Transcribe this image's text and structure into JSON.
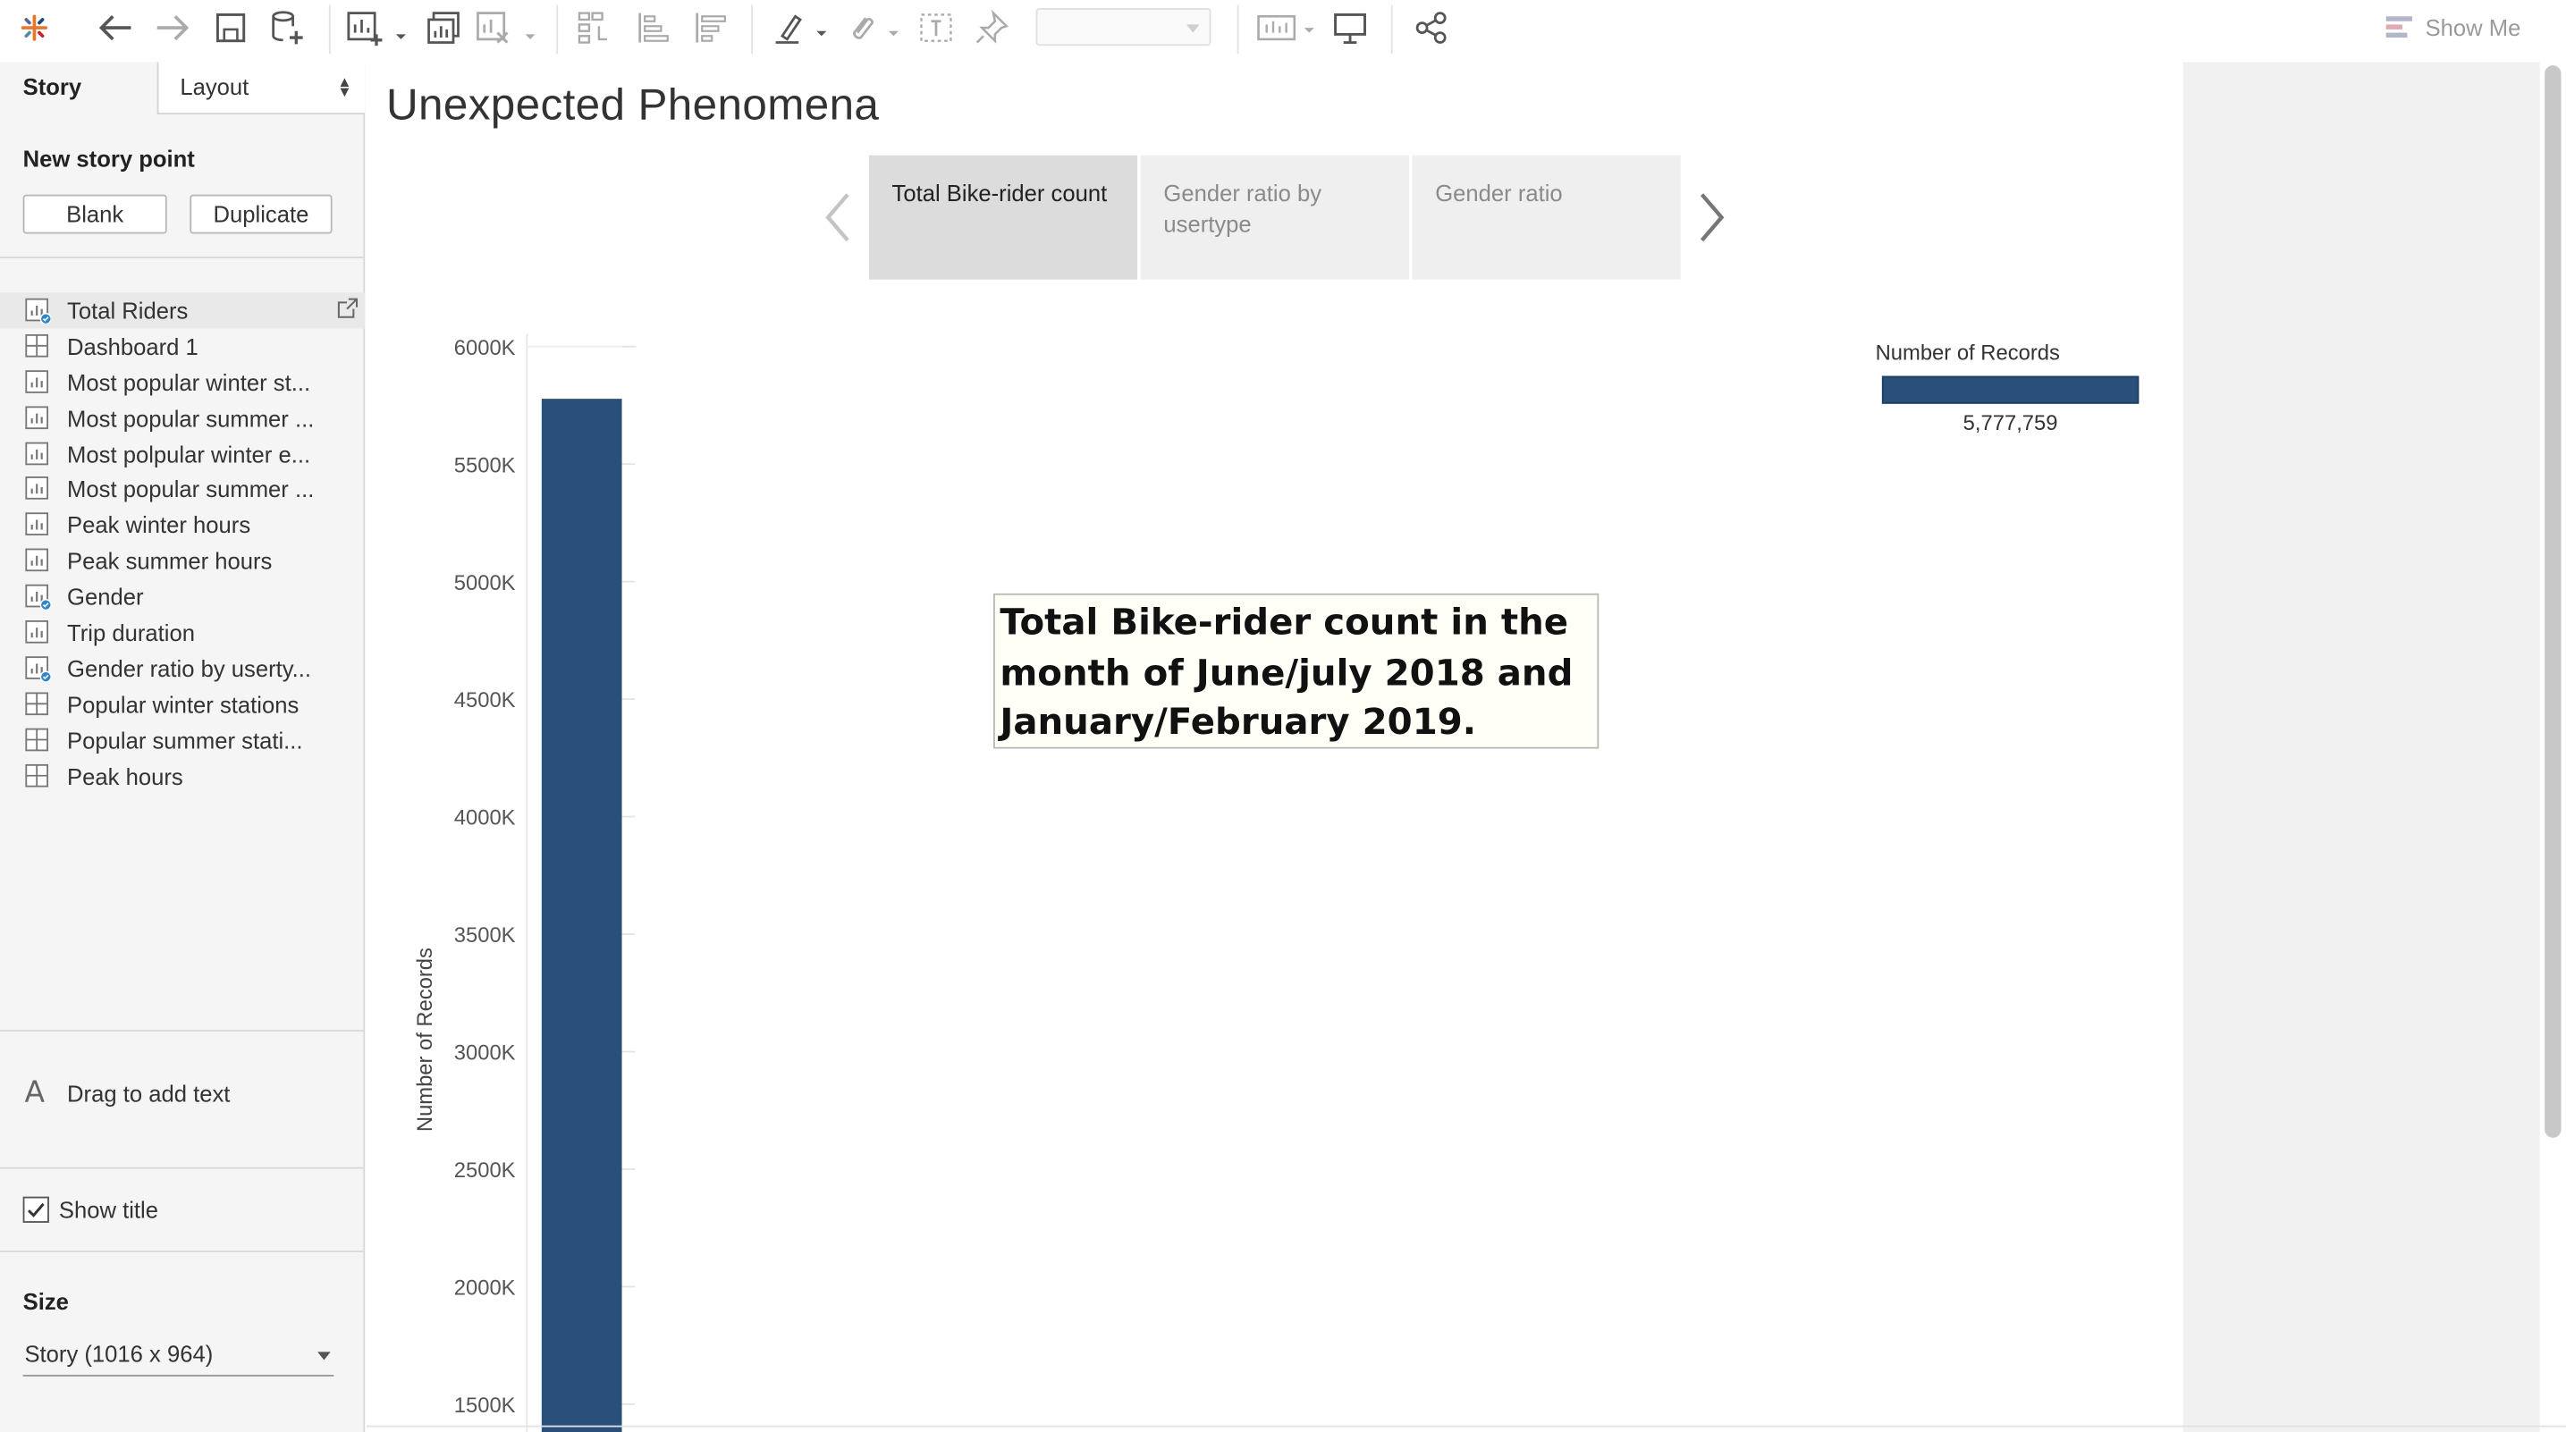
{
  "toolbar": {
    "show_me_label": "Show Me",
    "icons": [
      "tableau-logo-icon",
      "undo-icon",
      "redo-icon",
      "save-icon",
      "new-datasource-icon",
      "new-worksheet-icon",
      "duplicate-sheet-icon",
      "clear-sheet-icon",
      "swap-icon",
      "sort-ascending-icon",
      "sort-descending-icon",
      "highlight-icon",
      "group-icon",
      "label-icon",
      "pin-icon",
      "fit-icon",
      "presentation-icon",
      "share-icon"
    ],
    "fit_value": ""
  },
  "left_pane": {
    "tab_story": "Story",
    "tab_layout": "Layout",
    "new_story_point": "New story point",
    "blank_button": "Blank",
    "duplicate_button": "Duplicate",
    "sheets": [
      {
        "label": "Total Riders",
        "type": "worksheet",
        "used": true,
        "active": true
      },
      {
        "label": "Dashboard 1",
        "type": "dashboard",
        "used": false,
        "active": false
      },
      {
        "label": "Most popular winter st...",
        "type": "worksheet",
        "used": false,
        "active": false
      },
      {
        "label": "Most popular summer ...",
        "type": "worksheet",
        "used": false,
        "active": false
      },
      {
        "label": "Most polpular winter e...",
        "type": "worksheet",
        "used": false,
        "active": false
      },
      {
        "label": "Most popular summer ...",
        "type": "worksheet",
        "used": false,
        "active": false
      },
      {
        "label": "Peak winter hours",
        "type": "worksheet",
        "used": false,
        "active": false
      },
      {
        "label": "Peak summer hours",
        "type": "worksheet",
        "used": false,
        "active": false
      },
      {
        "label": "Gender",
        "type": "worksheet",
        "used": true,
        "active": false
      },
      {
        "label": "Trip duration",
        "type": "worksheet",
        "used": false,
        "active": false
      },
      {
        "label": "Gender ratio by userty...",
        "type": "worksheet",
        "used": true,
        "active": false
      },
      {
        "label": "Popular winter stations",
        "type": "dashboard",
        "used": false,
        "active": false
      },
      {
        "label": "Popular summer stati...",
        "type": "dashboard",
        "used": false,
        "active": false
      },
      {
        "label": "Peak hours",
        "type": "dashboard",
        "used": false,
        "active": false
      }
    ],
    "drag_to_add_text": "Drag to add text",
    "show_title_label": "Show title",
    "show_title_checked": true,
    "size_label": "Size",
    "size_value": "Story (1016 x 964)"
  },
  "story": {
    "title": "Unexpected Phenomena",
    "story_points": [
      {
        "label": "Total Bike-rider count",
        "active": true
      },
      {
        "label": "Gender ratio by usertype",
        "active": false
      },
      {
        "label": "Gender ratio",
        "active": false
      }
    ],
    "annotation": "Total Bike-rider count in the month of June/july 2018 and January/February 2019."
  },
  "chart_data": {
    "type": "bar",
    "categories": [
      ""
    ],
    "values": [
      5777759
    ],
    "ylabel": "Number of Records",
    "y_ticks": [
      "6000K",
      "5500K",
      "5000K",
      "4500K",
      "4000K",
      "3500K",
      "3000K",
      "2500K",
      "2000K",
      "1500K"
    ],
    "y_tick_values": [
      6000000,
      5500000,
      5000000,
      4500000,
      4000000,
      3500000,
      3000000,
      2500000,
      2000000,
      1500000
    ],
    "ylim": [
      1500000,
      6000000
    ],
    "bar_color": "#28507a",
    "legend": {
      "title": "Number of Records",
      "value_label": "5,777,759"
    },
    "grid": false
  },
  "colors": {
    "accent": "#28507a",
    "active_story_point": "#dcdcdc",
    "inactive_story_point": "#efefef",
    "badge": "#2e87c8"
  }
}
